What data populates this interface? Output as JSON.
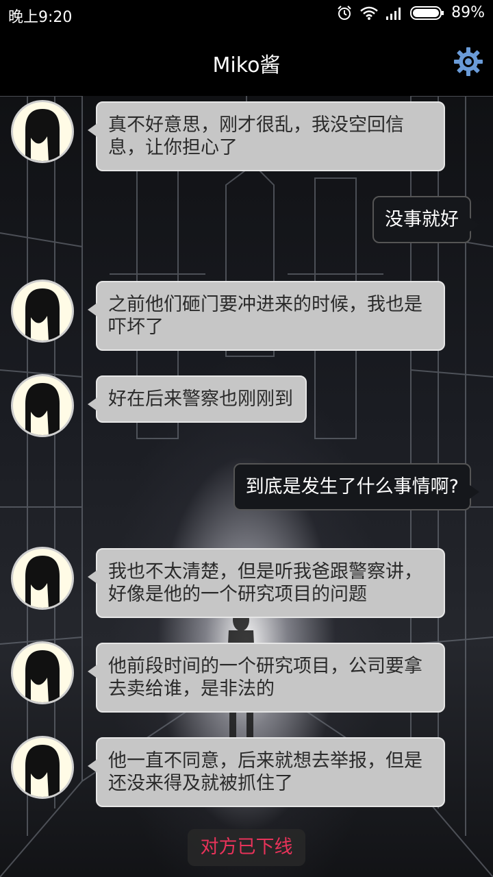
{
  "status_bar": {
    "time": "晚上9:20",
    "battery": "89%"
  },
  "header": {
    "title": "Miko酱",
    "settings_icon": "gear-icon"
  },
  "messages": [
    {
      "from": "other",
      "text": "真不好意思，刚才很乱，我没空回信息，让你担心了"
    },
    {
      "from": "me",
      "text": "没事就好"
    },
    {
      "from": "other",
      "text": "之前他们砸门要冲进来的时候，我也是吓坏了"
    },
    {
      "from": "other",
      "text": "好在后来警察也刚刚到"
    },
    {
      "from": "me",
      "text": "到底是发生了什么事情啊?"
    },
    {
      "from": "other",
      "text": "我也不太清楚，但是听我爸跟警察讲，好像是他的一个研究项目的问题"
    },
    {
      "from": "other",
      "text": "他前段时间的一个研究项目，公司要拿去卖给谁，是非法的"
    },
    {
      "from": "other",
      "text": "他一直不同意，后来就想去举报，但是还没来得及就被抓住了"
    }
  ],
  "footer": {
    "status": "对方已下线",
    "status_color": "#e8335a"
  }
}
